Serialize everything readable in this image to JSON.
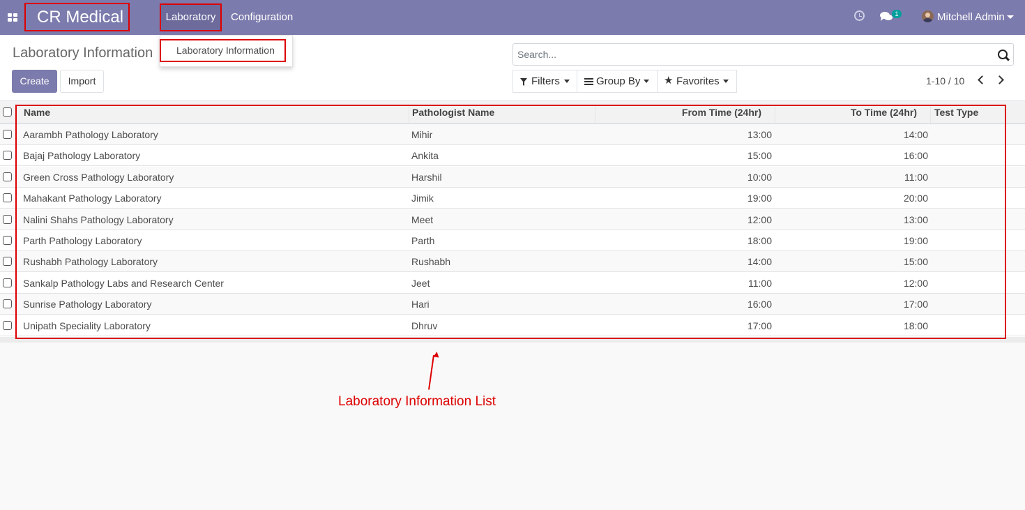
{
  "navbar": {
    "brand": "CR Medical",
    "menu": [
      "Laboratory",
      "Configuration"
    ],
    "badge_count": "1",
    "user": "Mitchell Admin"
  },
  "dropdown": {
    "item": "Laboratory Information"
  },
  "control_panel": {
    "breadcrumb": "Laboratory Information",
    "create_label": "Create",
    "import_label": "Import",
    "search_placeholder": "Search...",
    "filters_label": "Filters",
    "group_by_label": "Group By",
    "favorites_label": "Favorites",
    "pager": "1-10 / 10"
  },
  "table": {
    "columns": [
      "Name",
      "Pathologist Name",
      "From Time (24hr)",
      "To Time (24hr)",
      "Test Type"
    ],
    "rows": [
      {
        "name": "Aarambh Pathology Laboratory",
        "pathologist": "Mihir",
        "from": "13:00",
        "to": "14:00",
        "type": ""
      },
      {
        "name": "Bajaj Pathology Laboratory",
        "pathologist": "Ankita",
        "from": "15:00",
        "to": "16:00",
        "type": ""
      },
      {
        "name": "Green Cross Pathology Laboratory",
        "pathologist": "Harshil",
        "from": "10:00",
        "to": "11:00",
        "type": ""
      },
      {
        "name": "Mahakant Pathology Laboratory",
        "pathologist": "Jimik",
        "from": "19:00",
        "to": "20:00",
        "type": ""
      },
      {
        "name": "Nalini Shahs Pathology Laboratory",
        "pathologist": "Meet",
        "from": "12:00",
        "to": "13:00",
        "type": ""
      },
      {
        "name": "Parth Pathology Laboratory",
        "pathologist": "Parth",
        "from": "18:00",
        "to": "19:00",
        "type": ""
      },
      {
        "name": "Rushabh Pathology Laboratory",
        "pathologist": "Rushabh",
        "from": "14:00",
        "to": "15:00",
        "type": ""
      },
      {
        "name": "Sankalp Pathology Labs and Research Center",
        "pathologist": "Jeet",
        "from": "11:00",
        "to": "12:00",
        "type": ""
      },
      {
        "name": "Sunrise Pathology Laboratory",
        "pathologist": "Hari",
        "from": "16:00",
        "to": "17:00",
        "type": ""
      },
      {
        "name": "Unipath Speciality Laboratory",
        "pathologist": "Dhruv",
        "from": "17:00",
        "to": "18:00",
        "type": ""
      }
    ]
  },
  "annotation": {
    "text": "Laboratory Information List"
  },
  "colors": {
    "brand": "#7c7bad",
    "annotation": "#dd0000"
  },
  "icons": [
    "apps-icon",
    "clock-icon",
    "chat-icon",
    "avatar",
    "caret-down-icon",
    "search-icon",
    "filter-icon",
    "group-by-icon",
    "star-icon",
    "chevron-left-icon",
    "chevron-right-icon"
  ]
}
